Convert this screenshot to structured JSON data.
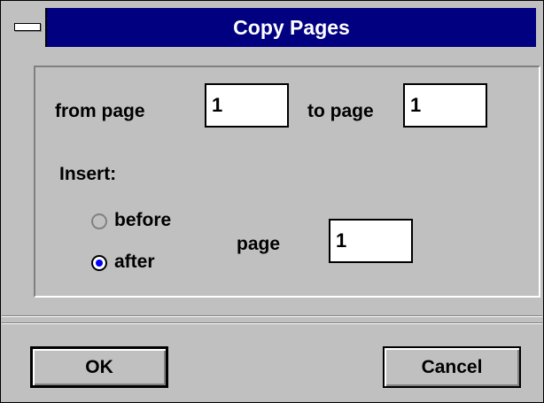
{
  "window": {
    "title": "Copy Pages"
  },
  "range": {
    "from_label": "from page",
    "from_value": "1",
    "to_label": "to page",
    "to_value": "1"
  },
  "insert": {
    "label": "Insert:",
    "options": [
      {
        "label": "before",
        "selected": false
      },
      {
        "label": "after",
        "selected": true
      }
    ],
    "page_label": "page",
    "page_value": "1"
  },
  "buttons": {
    "ok_label": "OK",
    "cancel_label": "Cancel"
  },
  "colors": {
    "titlebar": "#000080",
    "face": "#c0c0c0",
    "radio_dot": "#0000ff"
  },
  "icons": {
    "system_menu": "system-menu-icon"
  }
}
